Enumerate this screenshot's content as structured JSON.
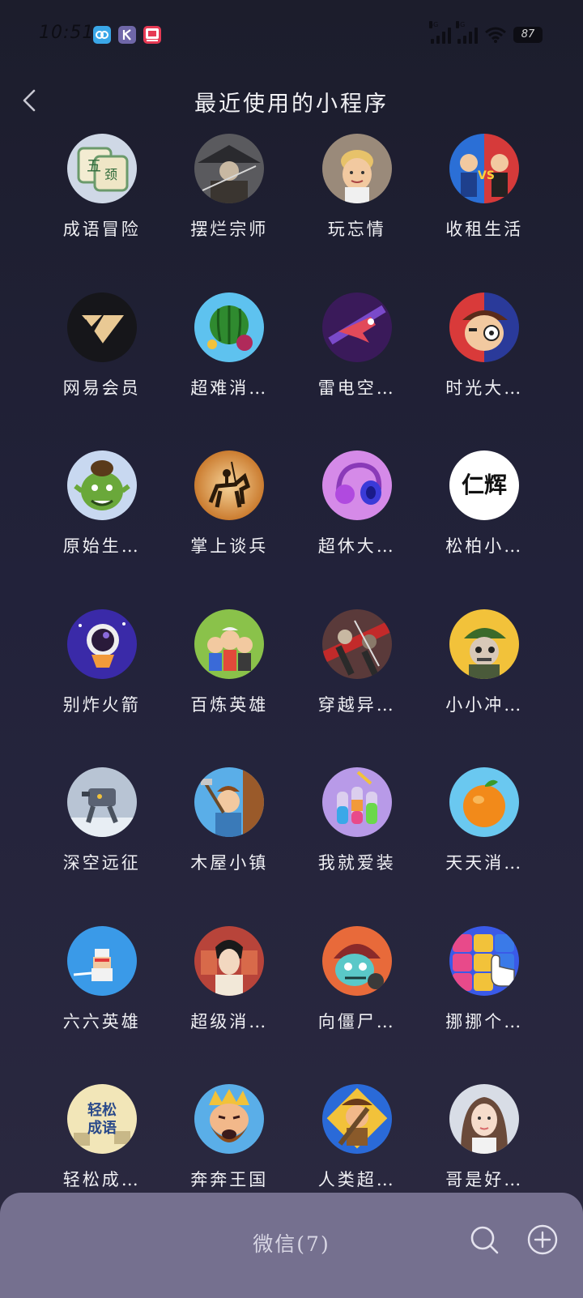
{
  "status_bar": {
    "time": "10:51",
    "signal_1_tag": "5G",
    "signal_2_tag": "5G",
    "battery": "87"
  },
  "header": {
    "title": "最近使用的小程序"
  },
  "apps": [
    {
      "label": "成语冒险",
      "icon": "mahjong-tile-icon"
    },
    {
      "label": "摆烂宗师",
      "icon": "swordsman-hat-icon"
    },
    {
      "label": "玩忘情",
      "icon": "blond-man-icon"
    },
    {
      "label": "收租生活",
      "icon": "versus-characters-icon"
    },
    {
      "label": "网易会员",
      "icon": "gold-v-logo-icon"
    },
    {
      "label": "超难消…",
      "icon": "watermelon-icon"
    },
    {
      "label": "雷电空…",
      "icon": "fighter-jet-icon"
    },
    {
      "label": "时光大…",
      "icon": "cartoon-boy-icon"
    },
    {
      "label": "原始生…",
      "icon": "green-orc-icon"
    },
    {
      "label": "掌上谈兵",
      "icon": "horse-rider-icon"
    },
    {
      "label": "超休大…",
      "icon": "headphones-icon"
    },
    {
      "label": "松柏小…",
      "icon": "renhui-text-icon",
      "icon_text": "仁辉"
    },
    {
      "label": "别炸火箭",
      "icon": "astronaut-icon"
    },
    {
      "label": "百炼英雄",
      "icon": "hero-group-icon"
    },
    {
      "label": "穿越异…",
      "icon": "warrior-fight-icon"
    },
    {
      "label": "小小冲…",
      "icon": "soldier-icon"
    },
    {
      "label": "深空远征",
      "icon": "mech-robot-icon"
    },
    {
      "label": "木屋小镇",
      "icon": "lumberjack-icon"
    },
    {
      "label": "我就爱装",
      "icon": "sort-bottles-icon"
    },
    {
      "label": "天天消…",
      "icon": "orange-fruit-icon"
    },
    {
      "label": "六六英雄",
      "icon": "pixel-ninja-icon"
    },
    {
      "label": "超级消…",
      "icon": "palace-lady-icon"
    },
    {
      "label": "向僵尸…",
      "icon": "zombie-icon"
    },
    {
      "label": "挪挪个…",
      "icon": "star-blocks-icon"
    },
    {
      "label": "轻松成…",
      "icon": "idiom-book-icon",
      "icon_text_1": "轻松",
      "icon_text_2": "成语"
    },
    {
      "label": "奔奔王国",
      "icon": "bearded-king-icon"
    },
    {
      "label": "人类超…",
      "icon": "caveman-icon"
    },
    {
      "label": "哥是好…",
      "icon": "girl-portrait-icon"
    }
  ],
  "bottom_bar": {
    "title": "微信(7)"
  },
  "colors": {
    "background": "#1c1d2c",
    "bottom_bar": "#75708f",
    "text": "#f0f0f4"
  }
}
